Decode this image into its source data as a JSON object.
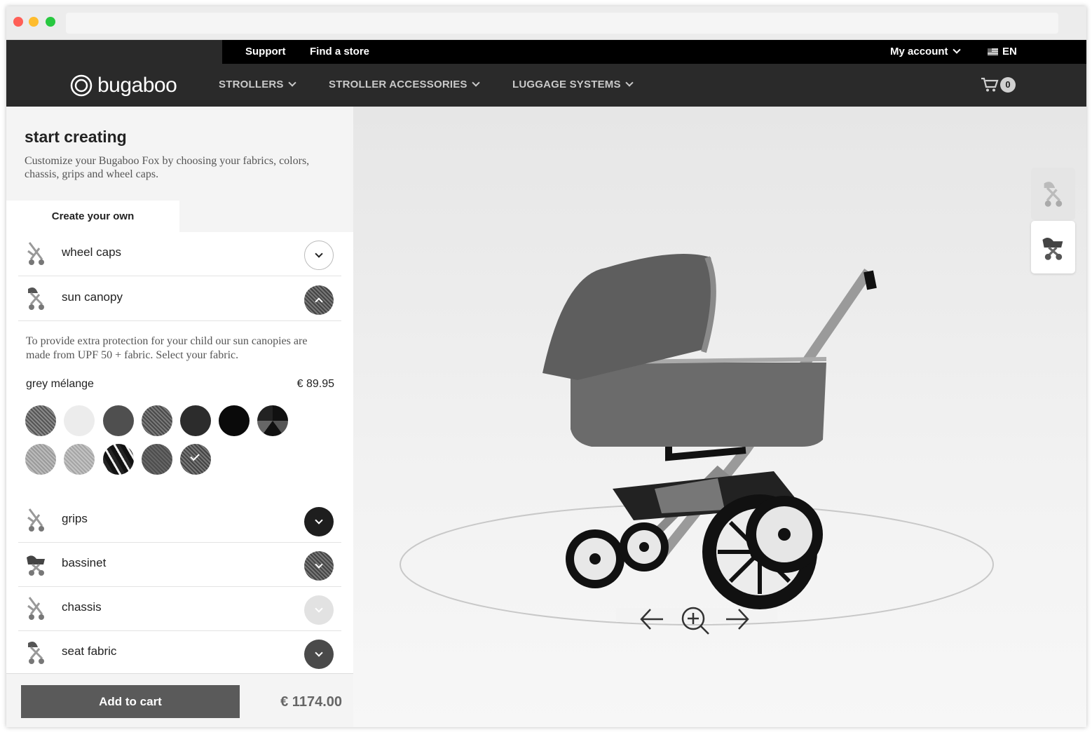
{
  "topbar": {
    "support": "Support",
    "find_store": "Find a store",
    "account": "My account",
    "language": "EN"
  },
  "nav": {
    "logo": "bugaboo",
    "items": [
      "STROLLERS",
      "STROLLER ACCESSORIES",
      "LUGGAGE SYSTEMS"
    ],
    "cart_count": "0"
  },
  "panel": {
    "title": "start creating",
    "subtitle": "Customize your Bugaboo Fox by choosing your fabrics, colors, chassis, grips and wheel caps.",
    "tab": "Create your own",
    "rows": [
      {
        "label": "wheel caps"
      },
      {
        "label": "sun canopy"
      },
      {
        "label": "grips"
      },
      {
        "label": "bassinet"
      },
      {
        "label": "chassis"
      },
      {
        "label": "seat fabric"
      }
    ],
    "canopy": {
      "description": "To provide extra protection for your child our sun canopies are made from UPF 50 + fabric. Select your fabric.",
      "selected_name": "grey mélange",
      "selected_price": "€ 89.95"
    },
    "add_to_cart": "Add to cart",
    "total": "€ 1174.00"
  },
  "colors": {
    "topbar": "#000000",
    "nav": "#2a2a2a",
    "button": "#5a5a5a"
  }
}
